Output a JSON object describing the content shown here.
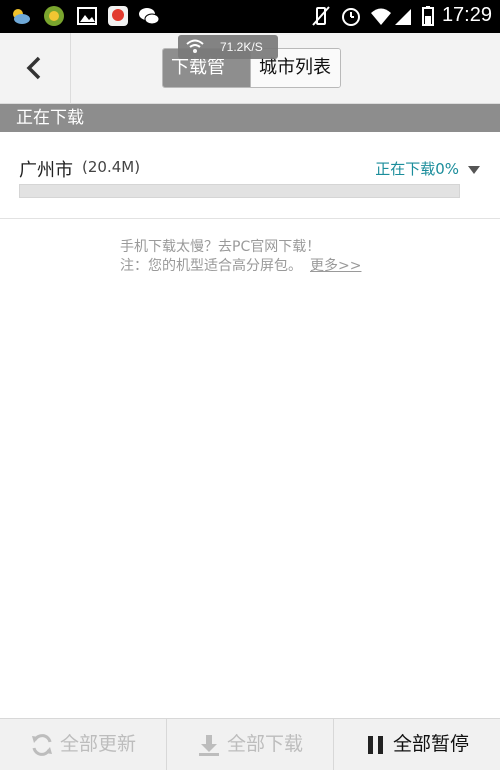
{
  "status_bar": {
    "time": "17:29",
    "icons": [
      "weather-icon",
      "game-icon",
      "gallery-icon",
      "app-du-icon",
      "wechat-icon",
      "vibrate-off-icon",
      "alarm-icon",
      "wifi-icon",
      "signal-icon",
      "battery-icon"
    ],
    "net_speed": "71.2K/S"
  },
  "header": {
    "back_label": "back",
    "tabs": [
      {
        "label": "下载管理",
        "active": true
      },
      {
        "label": "城市列表",
        "active": false
      }
    ]
  },
  "section": {
    "title": "正在下载"
  },
  "downloads": [
    {
      "city": "广州市",
      "size": "(20.4M)",
      "status": "正在下载0%",
      "progress": 0
    }
  ],
  "notice": {
    "line1": "手机下载太慢？去PC官网下载！",
    "line2": "注：您的机型适合高分屏包。",
    "more_link": "更多>>"
  },
  "bottom_bar": {
    "update_all": "全部更新",
    "download_all": "全部下载",
    "pause_all": "全部暂停"
  },
  "colors": {
    "accent": "#1b8d9b",
    "section_bg": "#8d8d8d",
    "active_tab_bg": "#8e8e8e"
  }
}
